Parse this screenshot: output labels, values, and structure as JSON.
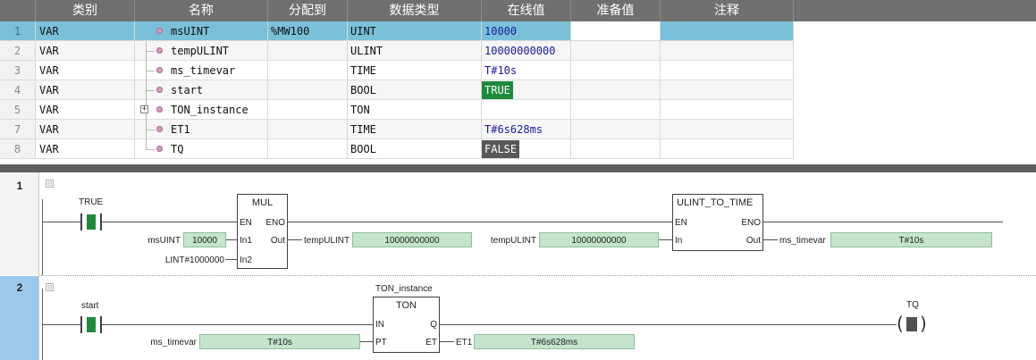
{
  "table": {
    "headers": [
      "",
      "类别",
      "名称",
      "分配到",
      "数据类型",
      "在线值",
      "准备值",
      "注释"
    ],
    "rows": [
      {
        "no": "1",
        "category": "VAR",
        "name": "msUINT",
        "assigned": "%MW100",
        "type": "UINT",
        "online": "10000"
      },
      {
        "no": "2",
        "category": "VAR",
        "name": "tempULINT",
        "assigned": "",
        "type": "ULINT",
        "online": "10000000000"
      },
      {
        "no": "3",
        "category": "VAR",
        "name": "ms_timevar",
        "assigned": "",
        "type": "TIME",
        "online": "T#10s"
      },
      {
        "no": "4",
        "category": "VAR",
        "name": "start",
        "assigned": "",
        "type": "BOOL",
        "online": "TRUE"
      },
      {
        "no": "5",
        "category": "VAR",
        "name": "TON_instance",
        "assigned": "",
        "type": "TON",
        "online": ""
      },
      {
        "no": "7",
        "category": "VAR",
        "name": "ET1",
        "assigned": "",
        "type": "TIME",
        "online": "T#6s628ms"
      },
      {
        "no": "8",
        "category": "VAR",
        "name": "TQ",
        "assigned": "",
        "type": "BOOL",
        "online": "FALSE"
      }
    ],
    "expander_symbol": "+"
  },
  "ladder": {
    "rung1": {
      "number": "1",
      "collapse_symbol": "⊟",
      "contact_value": "TRUE",
      "mul": {
        "title": "MUL",
        "pin_en": "EN",
        "pin_eno": "ENO",
        "pin_in1": "In1",
        "pin_in2": "In2",
        "pin_out": "Out",
        "in1_var": "msUINT",
        "in1_value": "10000",
        "in2_const": "LINT#1000000",
        "out_var": "tempULINT",
        "out_value": "10000000000"
      },
      "conv": {
        "title": "ULINT_TO_TIME",
        "pin_en": "EN",
        "pin_eno": "ENO",
        "pin_in": "In",
        "pin_out": "Out",
        "in_var": "tempULINT",
        "in_value": "10000000000",
        "out_var": "ms_timevar",
        "out_value": "T#10s"
      }
    },
    "rung2": {
      "number": "2",
      "collapse_symbol": "⊟",
      "contact_var": "start",
      "ton": {
        "instance": "TON_instance",
        "title": "TON",
        "pin_in": "IN",
        "pin_q": "Q",
        "pin_pt": "PT",
        "pin_et": "ET",
        "pt_var": "ms_timevar",
        "pt_value": "T#10s",
        "et_var": "ET1",
        "et_value": "T#6s628ms"
      },
      "coil_var": "TQ"
    }
  },
  "colors": {
    "header_bg": "#707070",
    "selected_row": "#7ac0d8",
    "value_box": "#c4e4cc",
    "true_badge": "#1f8a3c",
    "false_badge": "#585858",
    "active_gutter": "#9cc8ec"
  },
  "icons": [
    "variable-icon",
    "tree-expander-plus-icon",
    "rung-collapse-icon",
    "contact-icon",
    "coil-icon"
  ]
}
